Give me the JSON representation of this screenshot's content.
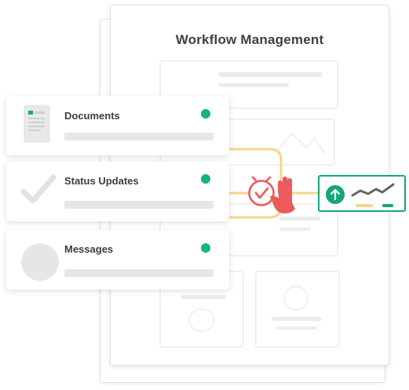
{
  "app": {
    "title": "Workflow Management"
  },
  "cards": [
    {
      "label": "Documents",
      "status": "online",
      "icon": "document-icon"
    },
    {
      "label": "Status Updates",
      "status": "online",
      "icon": "checkmark-icon"
    },
    {
      "label": "Messages",
      "status": "online",
      "icon": "message-circle-icon"
    }
  ],
  "center_icons": [
    "clock-check-icon",
    "stop-hand-icon"
  ],
  "trend_widget": {
    "icons": [
      "upload-arrow-icon",
      "trend-line-icon"
    ]
  },
  "colors": {
    "accent": "#13a77a",
    "status_dot": "#13b47e",
    "connector": "#f5d68a",
    "alert": "#ec5b5b",
    "placeholder": "#e6e6e6"
  }
}
